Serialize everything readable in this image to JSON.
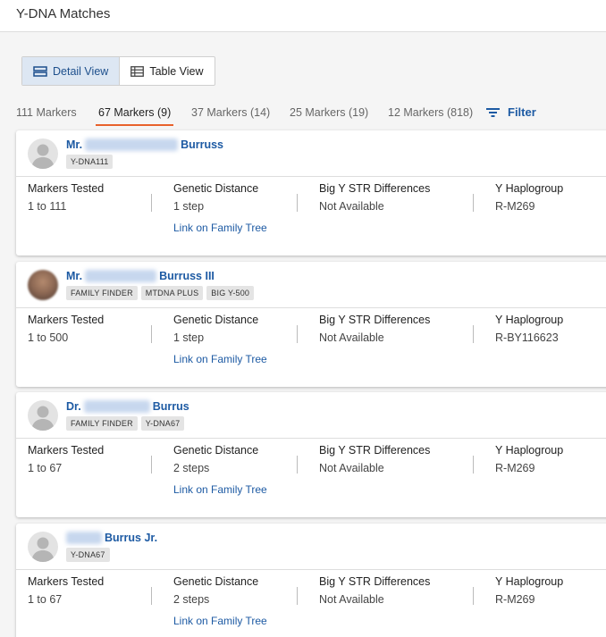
{
  "header": {
    "title": "Y-DNA Matches"
  },
  "views": {
    "detail_label": "Detail View",
    "table_label": "Table View"
  },
  "tabs": [
    {
      "label": "111 Markers"
    },
    {
      "label": "67 Markers (9)"
    },
    {
      "label": "37 Markers (14)"
    },
    {
      "label": "25 Markers (19)"
    },
    {
      "label": "12 Markers (818)"
    }
  ],
  "filter": {
    "label": "Filter"
  },
  "columns": {
    "markers_tested": "Markers Tested",
    "genetic_distance": "Genetic Distance",
    "big_y": "Big Y STR Differences",
    "haplogroup": "Y Haplogroup",
    "link_label": "Link on Family Tree"
  },
  "matches": [
    {
      "prefix": "Mr.",
      "suffix": "Burruss",
      "badges": [
        "Y-DNA111"
      ],
      "markers": "1 to 111",
      "distance": "1 step",
      "bigy": "Not Available",
      "haplogroup": "R-M269"
    },
    {
      "prefix": "Mr.",
      "suffix": "Burruss III",
      "badges": [
        "FAMILY FINDER",
        "MTDNA PLUS",
        "BIG Y-500"
      ],
      "markers": "1 to 500",
      "distance": "1 step",
      "bigy": "Not Available",
      "haplogroup": "R-BY116623"
    },
    {
      "prefix": "Dr.",
      "suffix": "Burrus",
      "badges": [
        "FAMILY FINDER",
        "Y-DNA67"
      ],
      "markers": "1 to 67",
      "distance": "2 steps",
      "bigy": "Not Available",
      "haplogroup": "R-M269"
    },
    {
      "prefix": "",
      "suffix": "Burrus Jr.",
      "badges": [
        "Y-DNA67"
      ],
      "markers": "1 to 67",
      "distance": "2 steps",
      "bigy": "Not Available",
      "haplogroup": "R-M269"
    }
  ]
}
